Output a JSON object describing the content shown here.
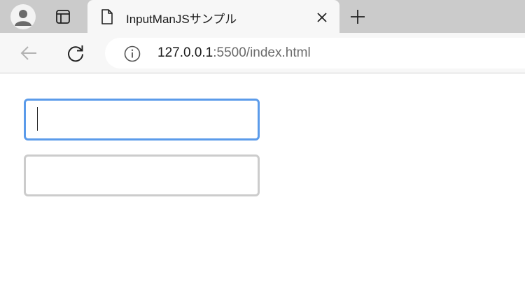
{
  "browser": {
    "tab": {
      "title": "InputManJSサンプル",
      "close_symbol": "✕"
    },
    "new_tab_symbol": "+",
    "address": {
      "host": "127.0.0.1",
      "rest": ":5500/index.html"
    },
    "icons": {
      "profile": "avatar-icon",
      "tab_actions": "tab-actions-icon",
      "page": "page-icon",
      "back": "back-arrow-icon",
      "refresh": "refresh-icon",
      "info": "info-icon"
    }
  },
  "page": {
    "fields": [
      {
        "value": "",
        "focused": true
      },
      {
        "value": "",
        "focused": false
      }
    ]
  },
  "colors": {
    "focus_border": "#5b9bea",
    "idle_border": "#cccccc",
    "tabstrip_bg": "#cbcbcb",
    "toolbar_bg": "#f7f7f7"
  }
}
